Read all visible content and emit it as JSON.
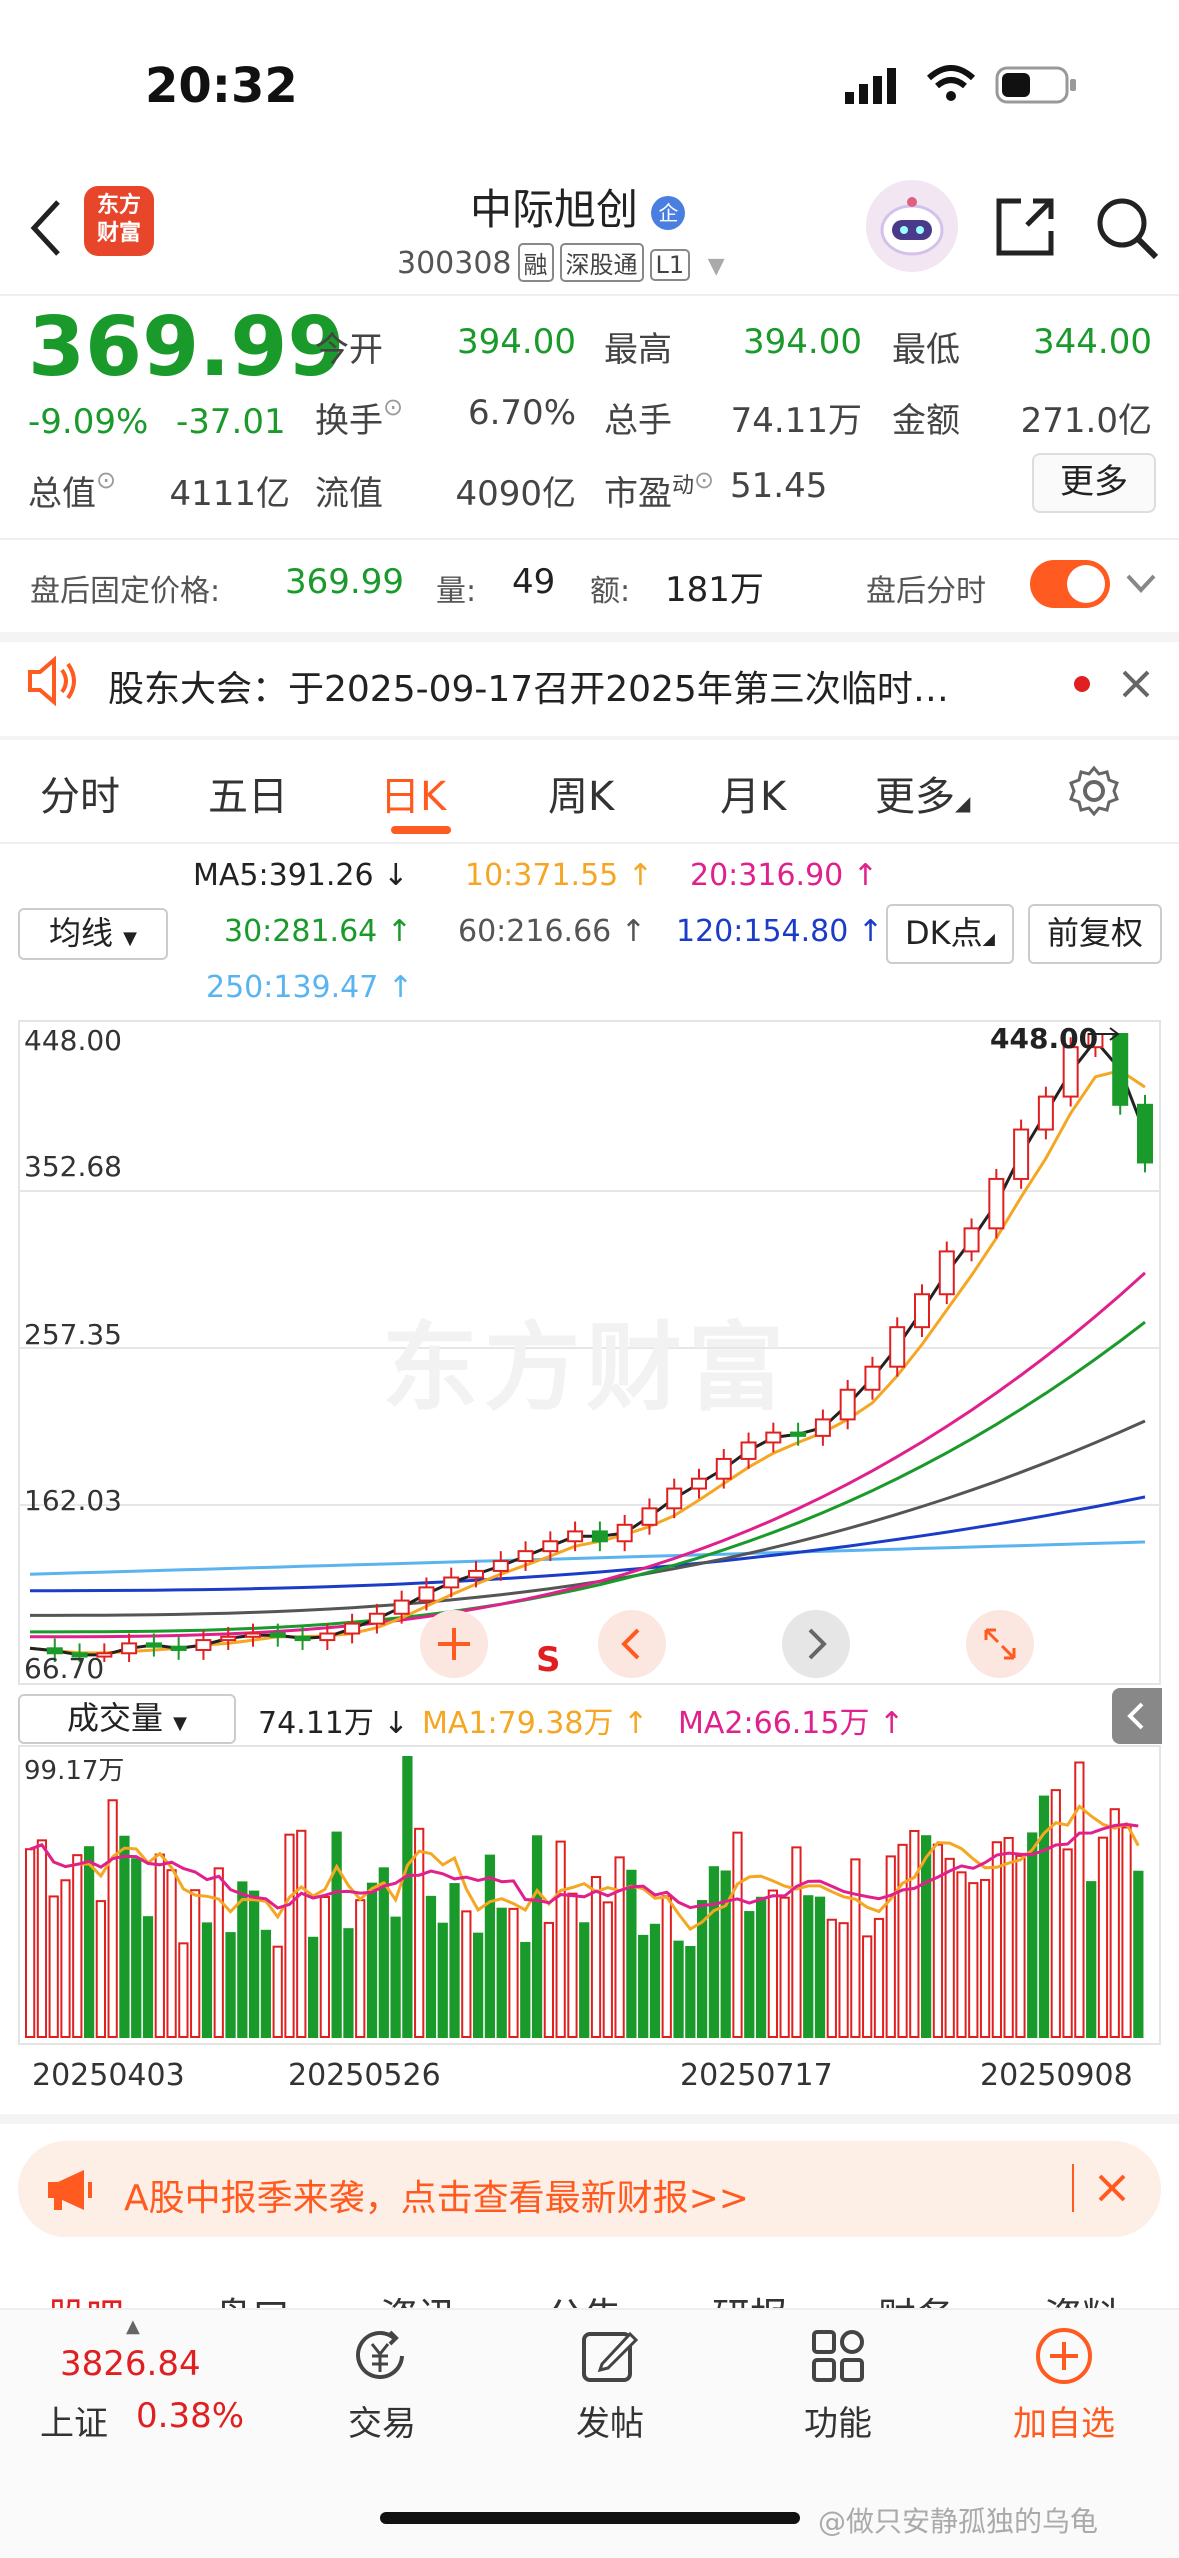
{
  "status": {
    "time": "20:32"
  },
  "header": {
    "logo_text": "东方\n财富",
    "title": "中际旭创",
    "code": "300308",
    "tags": [
      "融",
      "深股通",
      "L1"
    ],
    "icons": [
      "back-icon",
      "robot-assistant-icon",
      "share-icon",
      "search-icon"
    ]
  },
  "quote": {
    "price": "369.99",
    "change_pct": "-9.09%",
    "change_amt": "-37.01",
    "fields": [
      {
        "label": "今开",
        "value": "394.00",
        "color": "green"
      },
      {
        "label": "最高",
        "value": "394.00",
        "color": "green"
      },
      {
        "label": "最低",
        "value": "344.00",
        "color": "green"
      },
      {
        "label": "换手",
        "value": "6.70%",
        "color": "gray"
      },
      {
        "label": "总手",
        "value": "74.11万",
        "color": "gray"
      },
      {
        "label": "金额",
        "value": "271.0亿",
        "color": "gray"
      },
      {
        "label": "总值",
        "value": "4111亿",
        "color": "gray"
      },
      {
        "label": "流值",
        "value": "4090亿",
        "color": "gray"
      },
      {
        "label": "市盈",
        "value": "51.45",
        "color": "gray"
      }
    ],
    "pe_sup": "动",
    "more_button": "更多"
  },
  "after_hours": {
    "label": "盘后固定价格:",
    "price": "369.99",
    "vol_label": "量:",
    "vol": "49",
    "amt_label": "额:",
    "amt": "181万",
    "toggle_label": "盘后分时",
    "toggle_on": true
  },
  "notice": {
    "text": "股东大会：于2025-09-17召开2025年第三次临时…"
  },
  "tabs": [
    {
      "label": "分时",
      "active": false
    },
    {
      "label": "五日",
      "active": false
    },
    {
      "label": "日K",
      "active": true
    },
    {
      "label": "周K",
      "active": false
    },
    {
      "label": "月K",
      "active": false
    },
    {
      "label": "更多",
      "active": false
    }
  ],
  "ma_legend": {
    "selector": "均线",
    "ma5": "MA5:391.26 ↓",
    "ma10": "10:371.55 ↑",
    "ma20": "20:316.90 ↑",
    "ma30": "30:281.64 ↑",
    "ma60": "60:216.66 ↑",
    "ma120": "120:154.80 ↑",
    "ma250": "250:139.47 ↑",
    "dk_button": "DK点",
    "fq_button": "前复权",
    "colors": {
      "ma5": "#222222",
      "ma10": "#f5a623",
      "ma20": "#e0208c",
      "ma30": "#1a9a2a",
      "ma60": "#555555",
      "ma120": "#1a3cc8",
      "ma250": "#5ab4f0"
    }
  },
  "kline": {
    "axis_labels": [
      "448.00",
      "352.68",
      "257.35",
      "162.03",
      "66.70"
    ],
    "high_marker": "448.00",
    "low_marker": "66.70",
    "watermark": "东方财富",
    "controls": [
      "plus-icon",
      "S",
      "chevron-left-icon",
      "chevron-right-icon",
      "expand-icon"
    ],
    "s_label": "S"
  },
  "volume": {
    "selector": "成交量",
    "current": "74.11万 ↓",
    "ma1": "MA1:79.38万 ↑",
    "ma2": "MA2:66.15万 ↑",
    "max_label": "99.17万",
    "dates": [
      "20250403",
      "20250526",
      "20250717",
      "20250908"
    ]
  },
  "chart_data": {
    "type": "candlestick",
    "ylim": [
      66.7,
      448.0
    ],
    "high": 448.0,
    "low": 66.7,
    "close_last": 369.99,
    "ma_last": {
      "MA5": 391.26,
      "MA10": 371.55,
      "MA20": 316.9,
      "MA30": 281.64,
      "MA60": 216.66,
      "MA120": 154.8,
      "MA250": 139.47
    },
    "approx_close_path": [
      75,
      72,
      70,
      72,
      78,
      76,
      74,
      80,
      82,
      84,
      82,
      80,
      84,
      90,
      96,
      104,
      112,
      118,
      122,
      128,
      134,
      140,
      146,
      140,
      150,
      160,
      172,
      178,
      190,
      200,
      206,
      204,
      214,
      232,
      246,
      270,
      290,
      316,
      330,
      360,
      390,
      410,
      440,
      448,
      405,
      370
    ]
  },
  "banner": {
    "text": "A股中报季来袭，点击查看最新财报>>"
  },
  "sub_tabs": [
    "股吧",
    "盘口",
    "资讯",
    "公告",
    "研报",
    "财务",
    "资料"
  ],
  "bottom": {
    "index_value": "3826.84",
    "index_name": "上证",
    "index_change": "0.38%",
    "nav": [
      "交易",
      "发帖",
      "功能",
      "加自选"
    ],
    "watermark": "@做只安静孤独的乌龟"
  }
}
